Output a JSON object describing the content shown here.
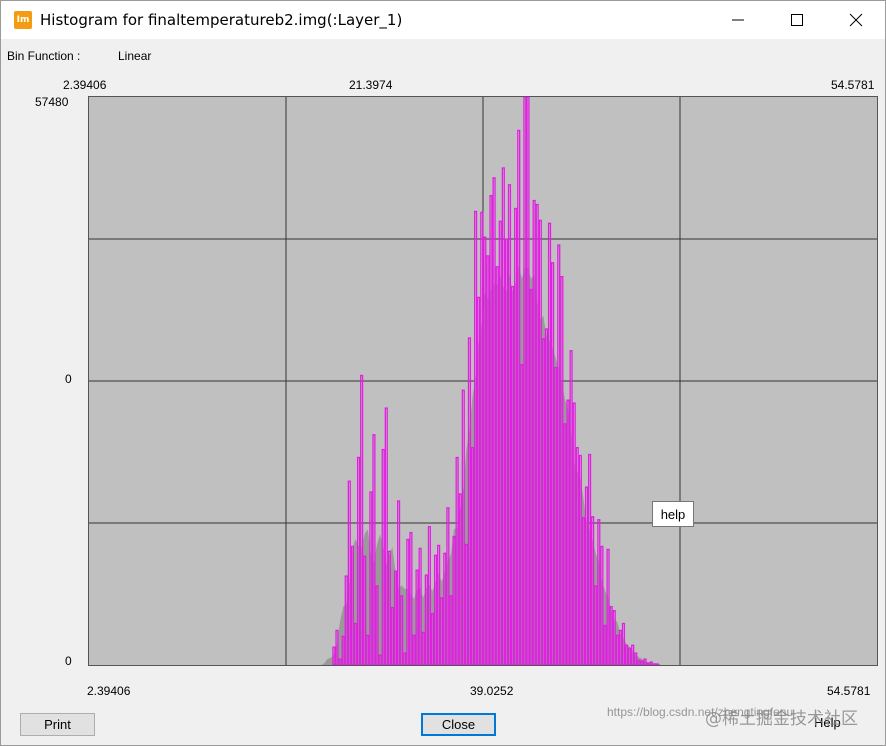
{
  "window": {
    "title": "Histogram for finaltemperatureb2.img(:Layer_1)",
    "icon_text": "Im"
  },
  "bin_function": {
    "label": "Bin Function :",
    "value": "Linear"
  },
  "top_axis": {
    "left": "2.39406",
    "mid": "21.3974",
    "right": "54.5781"
  },
  "y_axis": {
    "top": "57480",
    "mid": "0",
    "bottom": "0"
  },
  "bottom_axis": {
    "left": "2.39406",
    "mid": "39.0252",
    "right": "54.5781"
  },
  "tooltip": "help",
  "buttons": {
    "print": "Print",
    "close": "Close",
    "help": "Help"
  },
  "watermark": {
    "url": "https://blog.csdn.net/zhengtingfenu",
    "text": "@稀土掘金技术社区"
  },
  "colors": {
    "plot_bg": "#c0c0c0",
    "bars": "#e020e0",
    "fill": "#9a9a9a",
    "grid": "#333333"
  },
  "chart_data": {
    "type": "bar",
    "title": "",
    "xlim": [
      2.39406,
      54.5781
    ],
    "ylim": [
      0,
      57480
    ],
    "x_start": 2.39406,
    "bin_width": 0.204,
    "grid": true,
    "values": [
      0,
      0,
      0,
      0,
      0,
      0,
      0,
      0,
      0,
      0,
      0,
      0,
      0,
      0,
      0,
      0,
      0,
      0,
      0,
      0,
      0,
      0,
      0,
      0,
      0,
      0,
      0,
      0,
      0,
      0,
      0,
      0,
      0,
      0,
      0,
      0,
      0,
      0,
      0,
      0,
      0,
      0,
      0,
      0,
      0,
      0,
      0,
      0,
      0,
      0,
      0,
      0,
      0,
      0,
      0,
      0,
      0,
      0,
      0,
      0,
      0,
      0,
      0,
      0,
      0,
      0,
      0,
      0,
      0,
      0,
      0,
      0,
      0,
      0,
      0,
      0,
      0,
      0,
      0,
      1800,
      3500,
      600,
      2900,
      9000,
      18600,
      12000,
      4200,
      21000,
      29300,
      11000,
      3000,
      17500,
      23300,
      8000,
      1000,
      21800,
      26000,
      11500,
      5800,
      9500,
      16600,
      7000,
      1200,
      12700,
      13400,
      3000,
      9600,
      11800,
      3300,
      9100,
      14000,
      5200,
      11100,
      12100,
      6800,
      11300,
      15900,
      7000,
      13000,
      21000,
      17300,
      27800,
      12200,
      33100,
      22000,
      45900,
      37200,
      45800,
      43300,
      41400,
      47500,
      49300,
      40300,
      44900,
      50300,
      43100,
      48600,
      38300,
      46200,
      54100,
      30400,
      57500,
      57500,
      38000,
      47000,
      46600,
      45000,
      33000,
      34000,
      44700,
      40700,
      30100,
      42500,
      39300,
      24400,
      26800,
      31800,
      26500,
      22000,
      21200,
      14900,
      18000,
      21300,
      15000,
      8000,
      14700,
      12000,
      4000,
      11700,
      5900,
      5500,
      3000,
      3500,
      4200,
      2000,
      1700,
      2000,
      1200,
      500,
      400,
      600,
      200,
      300,
      100,
      100,
      0
    ]
  }
}
